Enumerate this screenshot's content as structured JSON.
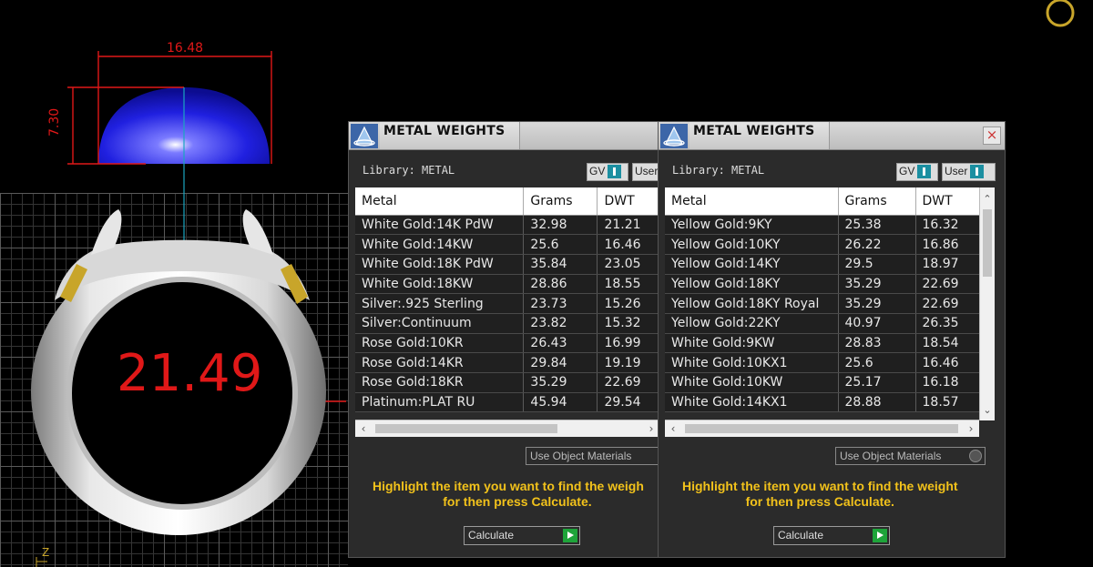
{
  "viewport": {
    "dimension_width": "16.48",
    "dimension_height": "7.30",
    "ring_size": "21.49",
    "axis_label": "Z"
  },
  "panels": [
    {
      "title": "METAL WEIGHTS",
      "library_label": "Library: METAL",
      "gv_label": "GV",
      "user_label": "User",
      "columns": [
        "Metal",
        "Grams",
        "DWT"
      ],
      "rows": [
        [
          "White Gold:14K PdW",
          "32.98",
          "21.21"
        ],
        [
          "White Gold:14KW",
          "25.6",
          "16.46"
        ],
        [
          "White Gold:18K PdW",
          "35.84",
          "23.05"
        ],
        [
          "White Gold:18KW",
          "28.86",
          "18.55"
        ],
        [
          "Silver:.925 Sterling",
          "23.73",
          "15.26"
        ],
        [
          "Silver:Continuum",
          "23.82",
          "15.32"
        ],
        [
          "Rose Gold:10KR",
          "26.43",
          "16.99"
        ],
        [
          "Rose Gold:14KR",
          "29.84",
          "19.19"
        ],
        [
          "Rose Gold:18KR",
          "35.29",
          "22.69"
        ],
        [
          "Platinum:PLAT RU",
          "45.94",
          "29.54"
        ]
      ],
      "use_object_materials": "Use Object Materials",
      "hint_line1": "Highlight the item you want to find the weigh",
      "hint_line2": "for then press Calculate.",
      "calculate_label": "Calculate"
    },
    {
      "title": "METAL WEIGHTS",
      "library_label": "Library: METAL",
      "gv_label": "GV",
      "user_label": "User",
      "close_label": "×",
      "columns": [
        "Metal",
        "Grams",
        "DWT"
      ],
      "rows": [
        [
          "Yellow Gold:9KY",
          "25.38",
          "16.32"
        ],
        [
          "Yellow Gold:10KY",
          "26.22",
          "16.86"
        ],
        [
          "Yellow Gold:14KY",
          "29.5",
          "18.97"
        ],
        [
          "Yellow Gold:18KY",
          "35.29",
          "22.69"
        ],
        [
          "Yellow Gold:18KY Royal",
          "35.29",
          "22.69"
        ],
        [
          "Yellow Gold:22KY",
          "40.97",
          "26.35"
        ],
        [
          "White Gold:9KW",
          "28.83",
          "18.54"
        ],
        [
          "White Gold:10KX1",
          "25.6",
          "16.46"
        ],
        [
          "White Gold:10KW",
          "25.17",
          "16.18"
        ],
        [
          "White Gold:14KX1",
          "28.88",
          "18.57"
        ]
      ],
      "use_object_materials": "Use Object Materials",
      "hint_line1": "Highlight the item you want to find the weight",
      "hint_line2": "for then press Calculate.",
      "calculate_label": "Calculate"
    }
  ],
  "colors": {
    "dimension_red": "#e01818",
    "hint_yellow": "#f2c21b",
    "toggle_teal": "#1b8fa1",
    "calc_green": "#1ea43a"
  }
}
